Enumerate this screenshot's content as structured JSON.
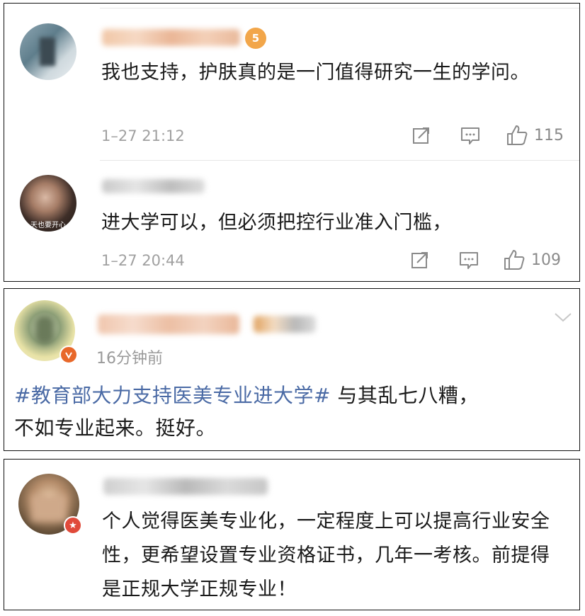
{
  "colors": {
    "hashtag": "#4a6aa5",
    "meta": "#a0a0a0",
    "text": "#1a1a1a",
    "badge_orange": "#e8682a",
    "badge_red": "#e04a3a"
  },
  "comment1": {
    "text": "我也支持，护肤真的是一门值得研究一生的学问。",
    "time": "1–27 21:12",
    "like_count": "115",
    "icons": [
      "share-icon",
      "comment-icon",
      "like-icon"
    ]
  },
  "comment2": {
    "text": "进大学可以，但必须把控行业准入门槛，",
    "time": "1–27 20:44",
    "like_count": "109",
    "avatar_caption": "天也要开心",
    "icons": [
      "share-icon",
      "comment-icon",
      "like-icon"
    ]
  },
  "post": {
    "time": "16分钟前",
    "hashtag": "#教育部大力支持医美专业进大学#",
    "text_after_hashtag": " 与其乱七八糟，",
    "text_line2": "不如专业起来。挺好。",
    "icons": [
      "chevron-down-icon",
      "verified-badge-icon"
    ]
  },
  "comment3": {
    "text": "个人觉得医美专业化，一定程度上可以提高行业安全性，更希望设置专业资格证书，几年一考核。前提得是正规大学正规专业！",
    "icons": [
      "star-badge-icon"
    ]
  }
}
